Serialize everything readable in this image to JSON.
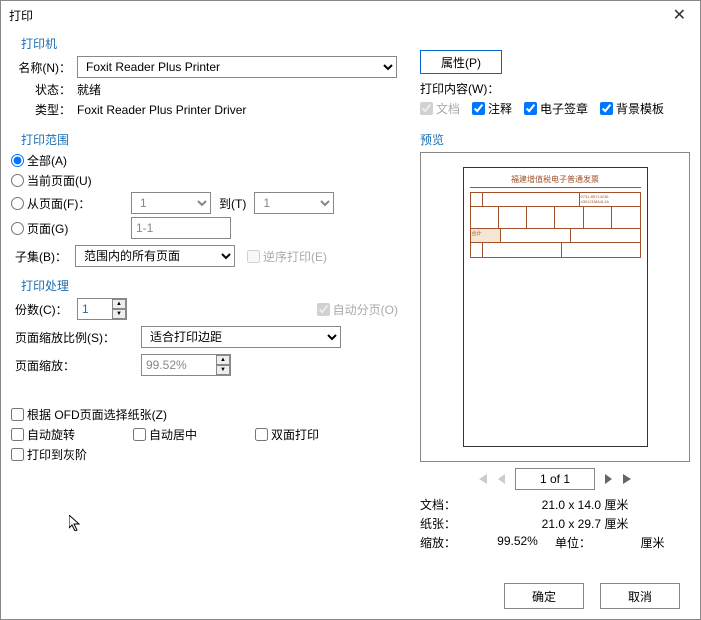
{
  "title": "打印",
  "printer": {
    "section": "打印机",
    "name_label": "名称(N)：",
    "name_value": "Foxit Reader Plus Printer",
    "status_label": "状态：",
    "status_value": "就绪",
    "type_label": "类型：",
    "type_value": "Foxit Reader Plus Printer Driver",
    "properties_btn": "属性(P)"
  },
  "print_content": {
    "label": "打印内容(W)：",
    "doc": "文档",
    "annot": "注释",
    "esign": "电子签章",
    "bgtpl": "背景模板"
  },
  "range": {
    "section": "打印范围",
    "all": "全部(A)",
    "current": "当前页面(U)",
    "from": "从页面(F)：",
    "from_val": "1",
    "to": "到(T)",
    "to_val": "1",
    "pages": "页面(G)",
    "pages_val": "1-1",
    "subset": "子集(B)：",
    "subset_val": "范围内的所有页面",
    "reverse": "逆序打印(E)"
  },
  "handling": {
    "section": "打印处理",
    "copies_label": "份数(C)：",
    "copies_val": "1",
    "collate": "自动分页(O)",
    "scale_mode_label": "页面缩放比例(S)：",
    "scale_mode_val": "适合打印边距",
    "scale_label": "页面缩放：",
    "scale_val": "99.52%",
    "ofd_paper": "根据 OFD页面选择纸张(Z)",
    "auto_rotate": "自动旋转",
    "auto_center": "自动居中",
    "duplex": "双面打印",
    "print_to_gray": "打印到灰阶"
  },
  "preview": {
    "section": "预览",
    "invoice_title": "福建增值税电子普通发票",
    "page_indicator": "1 of 1",
    "doc_label": "文档：",
    "doc_size": "21.0 x 14.0 厘米",
    "paper_label": "纸张：",
    "paper_size": "21.0 x 29.7 厘米",
    "zoom_label": "缩放：",
    "zoom_val": "99.52%",
    "unit_label": "单位：",
    "unit_val": "厘米"
  },
  "footer": {
    "ok": "确定",
    "cancel": "取消"
  }
}
